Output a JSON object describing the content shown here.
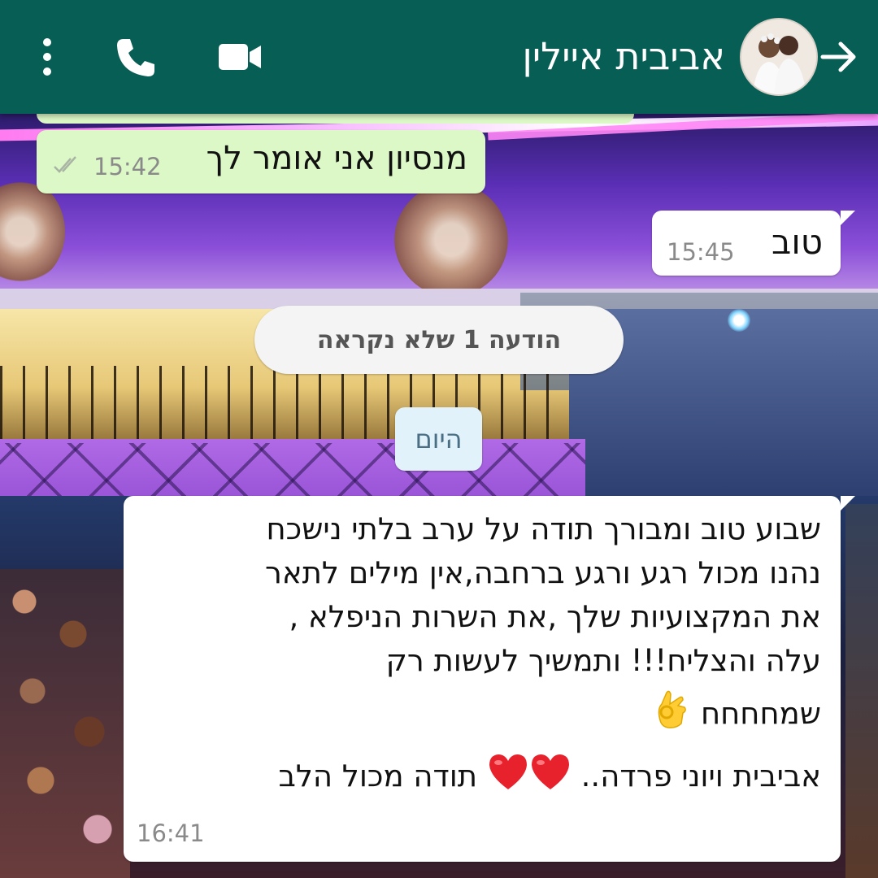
{
  "header": {
    "contact_name": "אביבית איילין",
    "icons": [
      "back-arrow-icon",
      "contact-avatar",
      "video-call-icon",
      "voice-call-icon",
      "more-options-icon"
    ],
    "color": "#075e54"
  },
  "messages": [
    {
      "direction": "outgoing",
      "text": "מנסיון אני אומר לך",
      "time": "15:42",
      "status": "double-check-icon"
    },
    {
      "direction": "incoming",
      "text": "טוב",
      "time": "15:45"
    }
  ],
  "unread_banner": "הודעה 1 שלא נקראה",
  "date_divider": "היום",
  "last_message": {
    "direction": "incoming",
    "lines": [
      "שבוע טוב ומבורך תודה על ערב בלתי נישכח",
      "נהנו מכול רגע ורגע ברחבה,אין מילים לתאר",
      "את המקצועיות שלך ,את השרות הניפלא ,",
      "עלה והצליח!!! ותמשיך לעשות רק",
      "שמחחחח",
      "תודה מכול הלב",
      "אביבית ויוני פרדה.."
    ],
    "emojis": [
      "ok-hand-emoji",
      "heart-emoji",
      "heart-emoji"
    ],
    "time": "16:41"
  },
  "colors": {
    "outgoing_bubble": "#dcf8c6",
    "incoming_bubble": "#ffffff",
    "unread_pill": "#f4f4f4",
    "date_pill": "#e1f2fb"
  }
}
